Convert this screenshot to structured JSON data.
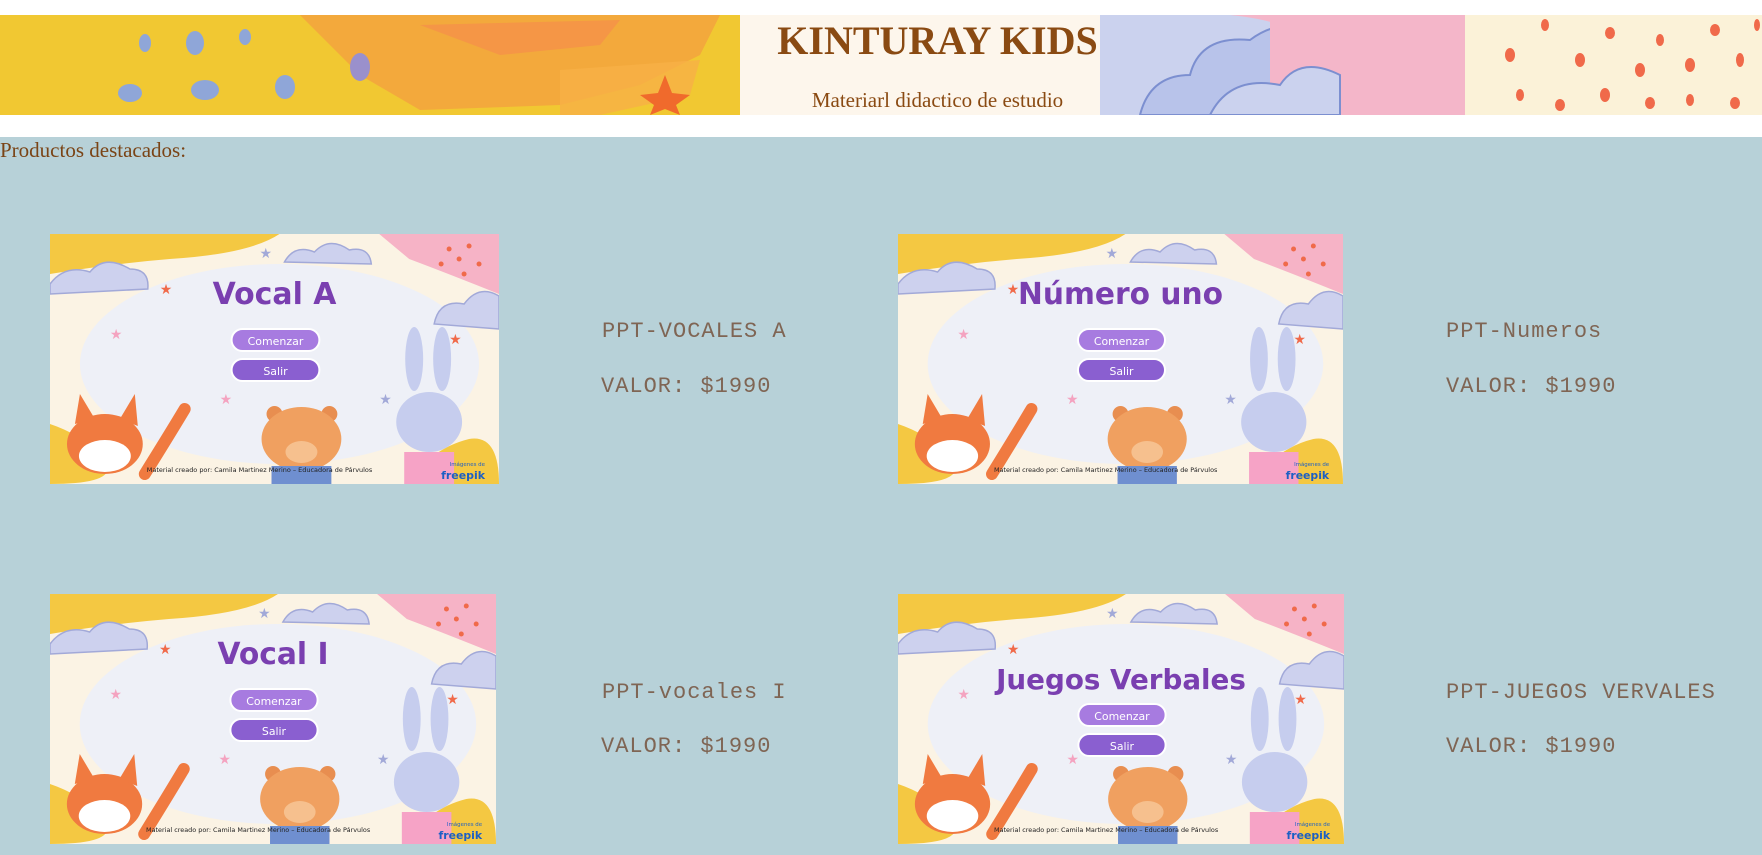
{
  "site": {
    "title": "KINTURAY KIDS",
    "subtitle": "Materiarl didactico de estudio"
  },
  "section": {
    "title": "Productos destacados:"
  },
  "products": [
    {
      "image_title": "Vocal A",
      "image_start": "Comenzar",
      "image_exit": "Salir",
      "image_credit": "Material creado por: Camila Martinez Merino – Educadora de Párvulos",
      "image_brand_top": "Imágenes de",
      "image_brand": "freepik",
      "name": "PPT-VOCALES A",
      "price": "VALOR: $1990"
    },
    {
      "image_title": "Número uno",
      "image_start": "Comenzar",
      "image_exit": "Salir",
      "image_credit": "Material creado por: Camila Martinez Merino – Educadora de Párvulos",
      "image_brand_top": "Imágenes de",
      "image_brand": "freepik",
      "name": "PPT-Numeros",
      "price": "VALOR: $1990"
    },
    {
      "image_title": "Vocal I",
      "image_start": "Comenzar",
      "image_exit": "Salir",
      "image_credit": "Material creado por: Camila Martinez Merino – Educadora de Párvulos",
      "image_brand_top": "Imágenes de",
      "image_brand": "freepik",
      "name": "PPT-vocales I",
      "price": "VALOR: $1990"
    },
    {
      "image_title": "Juegos Verbales",
      "image_start": "Comenzar",
      "image_exit": "Salir",
      "image_credit": "Material creado por: Camila Martinez Merino – Educadora de Párvulos",
      "image_brand_top": "Imágenes de",
      "image_brand": "freepik",
      "name": "PPT-JUEGOS VERVALES",
      "price": "VALOR: $1990"
    }
  ],
  "colors": {
    "page_bg": "#b7d1d8",
    "title_brown": "#8a4a12",
    "product_text": "#7f6554",
    "slide_title_purple": "#7a3fb0",
    "button_purple": "#a77be0"
  }
}
